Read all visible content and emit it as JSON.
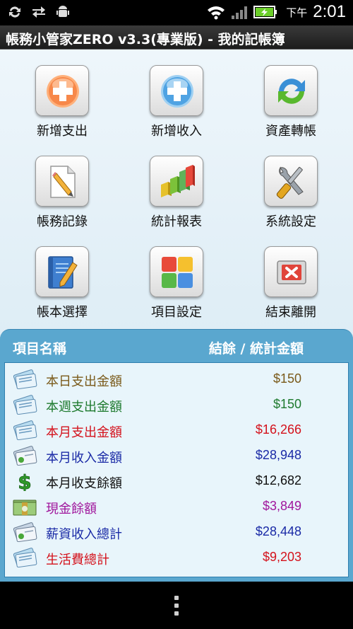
{
  "status_bar": {
    "clock_prefix": "下午",
    "clock": "2:01"
  },
  "title_bar": {
    "title": "帳務小管家ZERO v3.3(專業版) - 我的記帳簿"
  },
  "menu": [
    {
      "label": "新增支出",
      "icon": "add-expense-icon"
    },
    {
      "label": "新增收入",
      "icon": "add-income-icon"
    },
    {
      "label": "資產轉帳",
      "icon": "transfer-icon"
    },
    {
      "label": "帳務記錄",
      "icon": "records-icon"
    },
    {
      "label": "統計報表",
      "icon": "chart-icon"
    },
    {
      "label": "系統設定",
      "icon": "settings-icon"
    },
    {
      "label": "帳本選擇",
      "icon": "book-icon"
    },
    {
      "label": "項目設定",
      "icon": "category-icon"
    },
    {
      "label": "結束離開",
      "icon": "exit-icon"
    }
  ],
  "summary": {
    "header_item": "項目名稱",
    "header_value": "結餘 / 統計金額",
    "rows": [
      {
        "name": "本日支出金額",
        "value": "$150",
        "color": "#7a5a1a",
        "icon": "expense-card-icon"
      },
      {
        "name": "本週支出金額",
        "value": "$150",
        "color": "#1e7a2e",
        "icon": "expense-card-icon"
      },
      {
        "name": "本月支出金額",
        "value": "$16,266",
        "color": "#d4121c",
        "icon": "expense-card-icon"
      },
      {
        "name": "本月收入金額",
        "value": "$28,948",
        "color": "#1a2aa6",
        "icon": "income-card-icon"
      },
      {
        "name": "本月收支餘額",
        "value": "$12,682",
        "color": "#111111",
        "icon": "dollar-sign-icon"
      },
      {
        "name": "現金餘額",
        "value": "$3,849",
        "color": "#a0169c",
        "icon": "cash-icon"
      },
      {
        "name": "薪資收入總計",
        "value": "$28,448",
        "color": "#1a2aa6",
        "icon": "income-card-icon"
      },
      {
        "name": "生活費總計",
        "value": "$9,203",
        "color": "#d4121c",
        "icon": "expense-card-icon"
      }
    ]
  }
}
